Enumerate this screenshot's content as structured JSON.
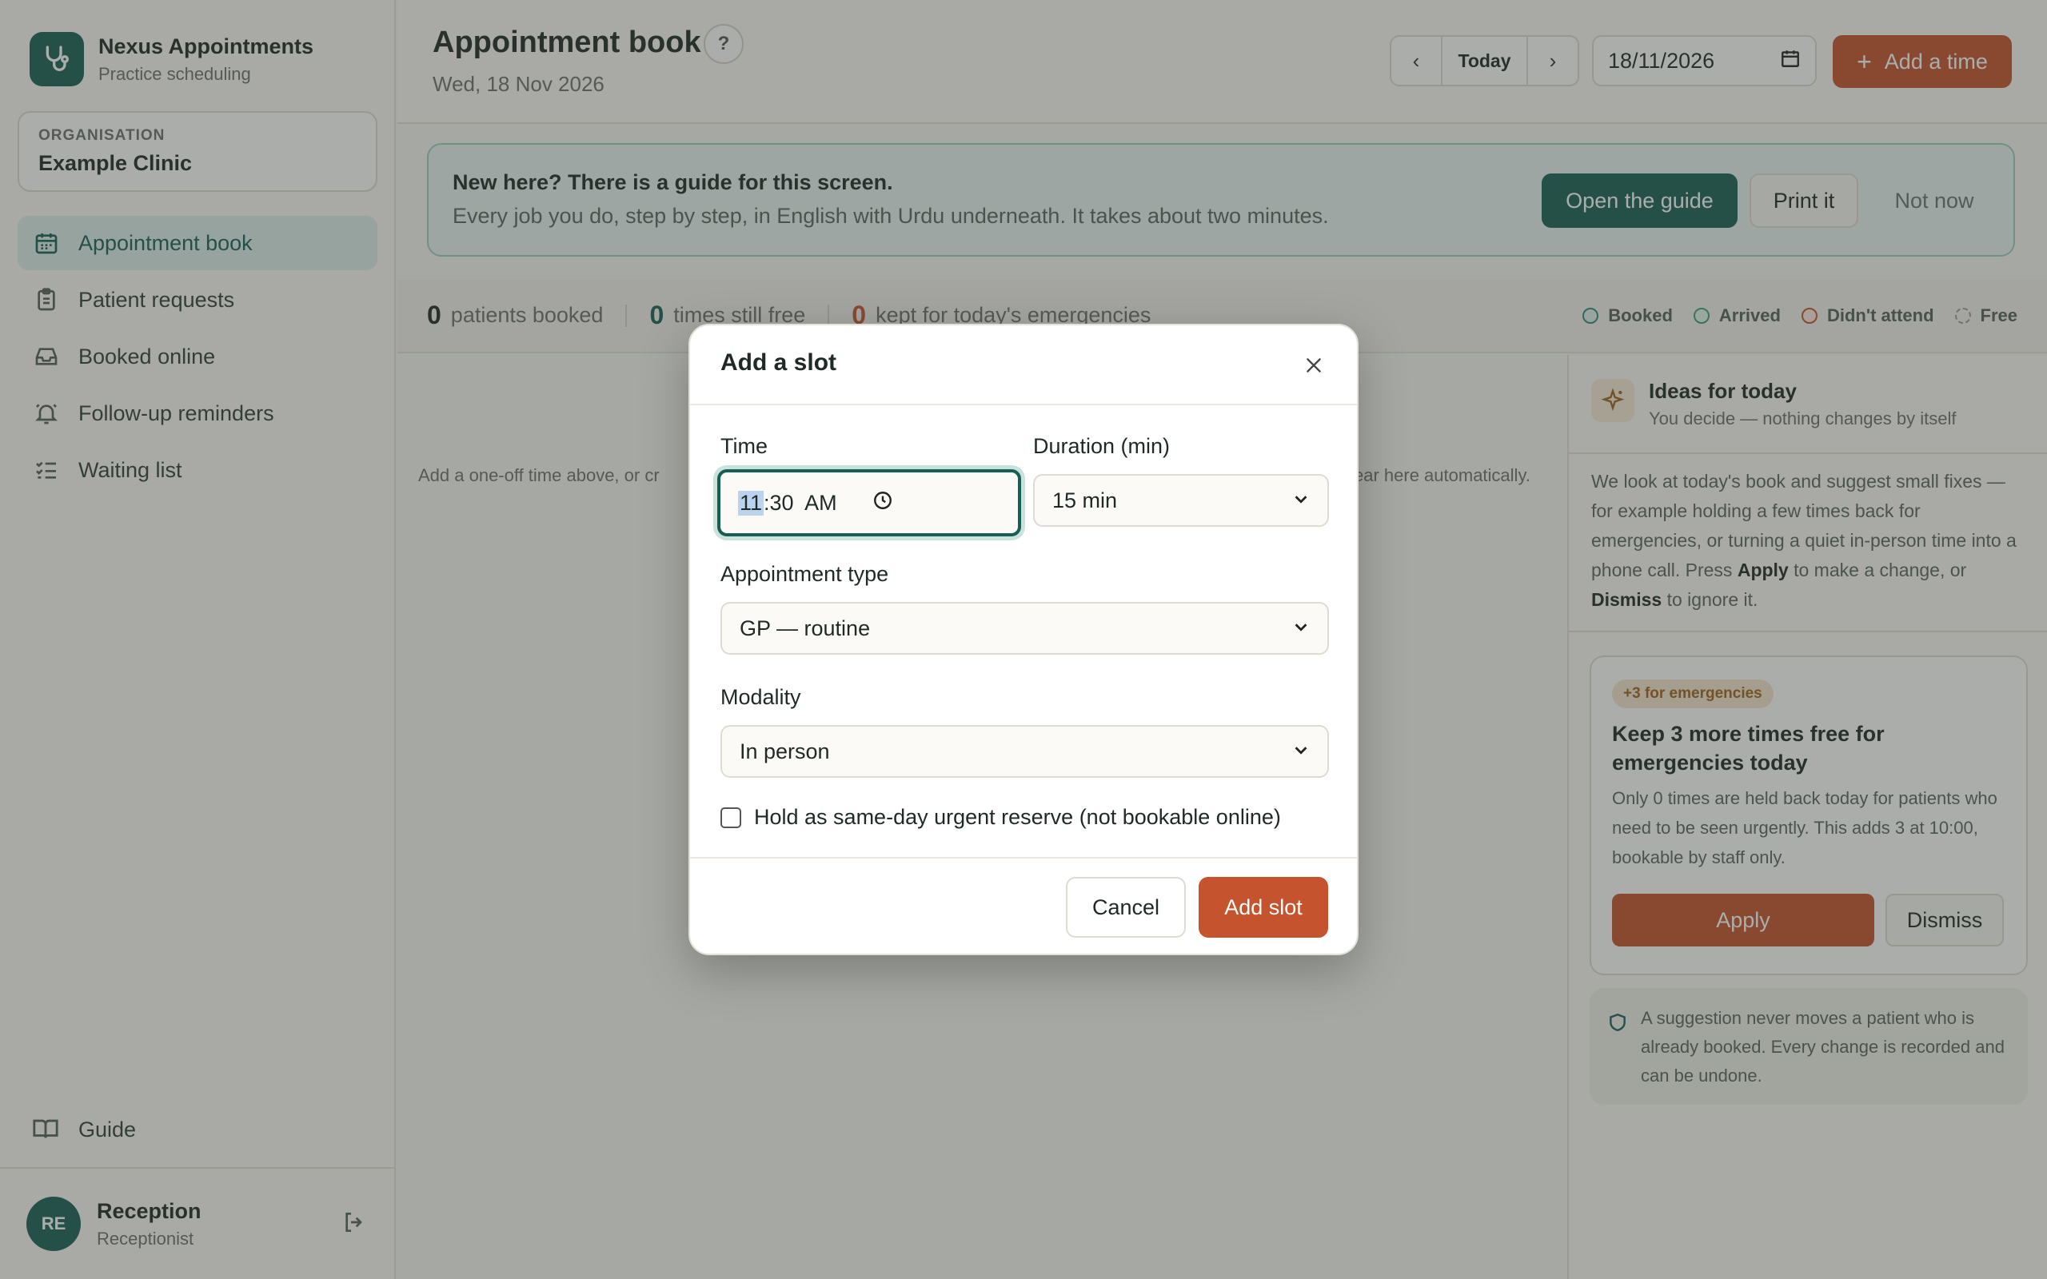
{
  "brand": {
    "name": "Nexus Appointments",
    "subtitle": "Practice scheduling"
  },
  "organisation": {
    "label": "ORGANISATION",
    "name": "Example Clinic"
  },
  "nav": {
    "items": [
      {
        "label": "Appointment book",
        "icon": "calendar-icon",
        "active": true
      },
      {
        "label": "Patient requests",
        "icon": "clipboard-icon"
      },
      {
        "label": "Booked online",
        "icon": "inbox-icon"
      },
      {
        "label": "Follow-up reminders",
        "icon": "bell-icon"
      },
      {
        "label": "Waiting list",
        "icon": "checklist-icon"
      }
    ],
    "guide": "Guide"
  },
  "user": {
    "initials": "RE",
    "name": "Reception",
    "role": "Receptionist"
  },
  "header": {
    "title": "Appointment book",
    "help": "?",
    "date": "Wed, 18 Nov 2026",
    "today": "Today",
    "date_value": "18/11/2026",
    "add_time": "Add a time"
  },
  "banner": {
    "title": "New here? There is a guide for this screen.",
    "subtitle": "Every job you do, step by step, in English with Urdu underneath. It takes about two minutes.",
    "open": "Open the guide",
    "print": "Print it",
    "dismiss": "Not now"
  },
  "stats": {
    "booked_count": "0",
    "booked_label": "patients booked",
    "free_count": "0",
    "free_label": "times still free",
    "reserved_count": "0",
    "reserved_label": "kept for today's emergencies"
  },
  "legend": [
    {
      "label": "Booked",
      "color": "#2f8a7a"
    },
    {
      "label": "Arrived",
      "color": "#3aa37a"
    },
    {
      "label": "Didn't attend",
      "color": "#c4532e"
    },
    {
      "label": "Free",
      "color": "#9a9a9a"
    }
  ],
  "empty": {
    "left": "Add a one-off time above, or cr",
    "right": "ear here automatically."
  },
  "ideas": {
    "title": "Ideas for today",
    "subtitle": "You decide — nothing changes by itself",
    "body_1": "We look at today's book and suggest small fixes — for example holding a few times back for emergencies, or turning a quiet in-person time into a phone call. Press ",
    "apply_word": "Apply",
    "body_2": " to make a change, or ",
    "dismiss_word": "Dismiss",
    "body_3": " to ignore it.",
    "suggestion": {
      "badge": "+3 for emergencies",
      "title": "Keep 3 more times free for emergencies today",
      "description": "Only 0 times are held back today for patients who need to be seen urgently. This adds 3 at 10:00, bookable by staff only.",
      "apply": "Apply",
      "dismiss": "Dismiss"
    },
    "note": "A suggestion never moves a patient who is already booked. Every change is recorded and can be undone."
  },
  "modal": {
    "title": "Add a slot",
    "time_label": "Time",
    "time_hour": "11",
    "time_rest": ":30  AM",
    "duration_label": "Duration (min)",
    "duration_value": "15 min",
    "type_label": "Appointment type",
    "type_value": "GP — routine",
    "modality_label": "Modality",
    "modality_value": "In person",
    "reserve_label": "Hold as same-day urgent reserve (not bookable online)",
    "cancel": "Cancel",
    "submit": "Add slot"
  },
  "colors": {
    "brand": "#175f55",
    "accent": "#c4532e"
  }
}
